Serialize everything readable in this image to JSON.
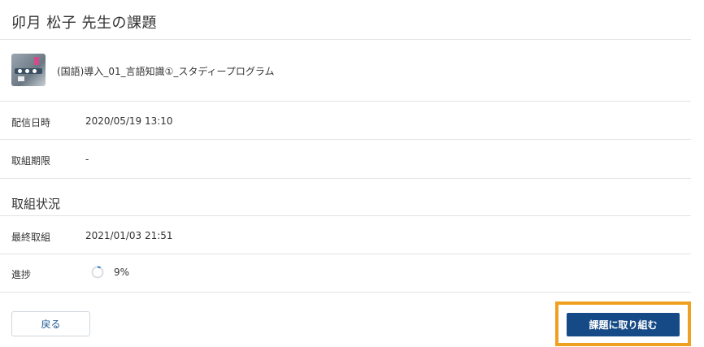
{
  "page": {
    "title": "卯月 松子 先生の課題"
  },
  "assignment": {
    "title": "(国語)導入_01_言語知識①_スタディープログラム",
    "thumbnail_icon": "assignment-thumbnail"
  },
  "details": {
    "delivery_label": "配信日時",
    "delivery_value": "2020/05/19 13:10",
    "deadline_label": "取組期限",
    "deadline_value": "-"
  },
  "status": {
    "section_title": "取組状況",
    "last_label": "最終取組",
    "last_value": "2021/01/03 21:51",
    "progress_label": "進捗",
    "progress_value": "9%",
    "progress_fraction": 0.09,
    "progress_color": "#2f7fd1"
  },
  "actions": {
    "back_label": "戻る",
    "start_label": "課題に取り組む",
    "highlight_color": "#f0a020",
    "primary_color": "#164a86"
  }
}
